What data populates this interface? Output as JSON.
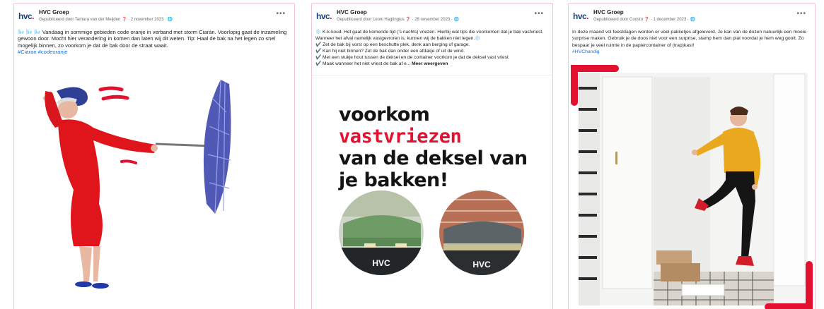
{
  "posts": [
    {
      "page_name": "HVC Groep",
      "meta": "Gepubliceerd door Tamara van der Meijden ❓ · 2 november 2023 · 🌐",
      "text": "🌬️ 🌬️ 🌬️ Vandaag in sommige gebieden code oranje in verband met storm Ciarán. Voorlopig gaat de inzameling gewoon door. Mocht hier verandering in komen dan laten wij dit weten. Tip: Haal de bak na het legen zo snel mogelijk binnen, zo voorkom je dat de bak door de straat waait.",
      "hashtags": "#Ciaran #codeoranje"
    },
    {
      "page_name": "HVC Groep",
      "meta": "Gepubliceerd door Leoni Hagtingius ❓ · 28 november 2023 · 🌐",
      "intro": "❄️ K-k-koud. Het gaat de komende tijd ('s nachts) vriezen. Hierbij wat tips die voorkomen dat je bak vastvriest. Wanneer het afval namelijk vastgevroren is, kunnen wij de bakken niet legen.❄️",
      "tips": [
        "✔️ Zet de bak bij vorst op een beschutte plek, denk aan berging of garage.",
        "✔️ Kan hij niet binnen? Zet de bak dan onder een afdakje of uit de wind.",
        "✔️ Met een stukje hout tussen de deksel en de container voorkom je dat de deksel vast vriest.",
        "✔️ Maak wanneer het niet vriest de bak af e..."
      ],
      "see_more": "Meer weergeven",
      "image_headline_1": "voorkom ",
      "image_headline_red": "vastvriezen",
      "image_headline_2": "van de deksel van",
      "image_headline_3": "je bakken!",
      "bin_label": "HVC"
    },
    {
      "page_name": "HVC Groep",
      "meta": "Gepubliceerd door Coosto ❓ · 1 december 2023 · 🌐",
      "text": "In deze maand vol feestdagen worden er veel pakketjes afgeleverd. Je kan van de dozen natuurlijk een mooie surprise maken. Gebruik je de doos niet voor een surprise, stamp hem dan plat voordat je hem weg gooit. Zo bespaar je veel ruimte in de papiercontainer of (trap)kast!",
      "hashtags": "#HVChandig"
    }
  ],
  "brand": {
    "logo_text": "hvc",
    "logo_dot": ".",
    "primary": "#1d3e7a",
    "accent": "#e3112f"
  },
  "icons": {
    "more": "more-horizontal-icon"
  }
}
